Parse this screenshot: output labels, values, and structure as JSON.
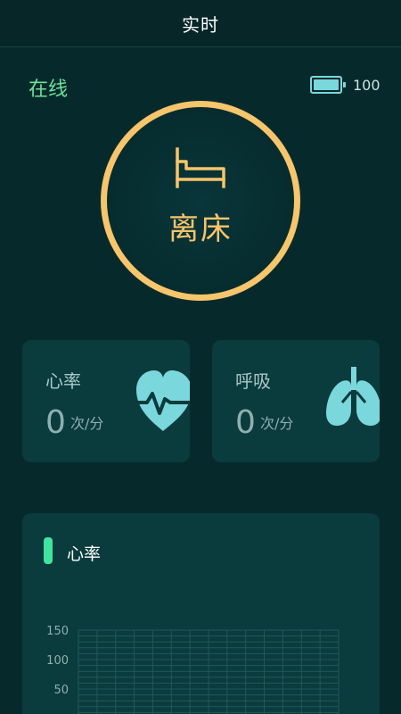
{
  "header": {
    "title": "实时"
  },
  "device": {
    "status": "在线",
    "battery_level": 100,
    "battery_text": "100"
  },
  "state": {
    "label": "离床",
    "icon": "bed-icon",
    "ring_color": "#f7c56b"
  },
  "metrics": {
    "heart": {
      "title": "心率",
      "value": "0",
      "unit": "次/分",
      "icon": "heart-rate-icon"
    },
    "breath": {
      "title": "呼吸",
      "value": "0",
      "unit": "次/分",
      "icon": "lungs-icon"
    }
  },
  "colors": {
    "background": "#062a2c",
    "card": "#0a3b3d",
    "accent_green": "#6ee29a",
    "accent_gold": "#f7c56b",
    "icon_cyan": "#7ad7dc"
  },
  "chart_data": {
    "type": "line",
    "title": "心率",
    "ylim": [
      0,
      150
    ],
    "yticks": [
      "150",
      "100",
      "50"
    ],
    "series": [],
    "grid": true
  }
}
